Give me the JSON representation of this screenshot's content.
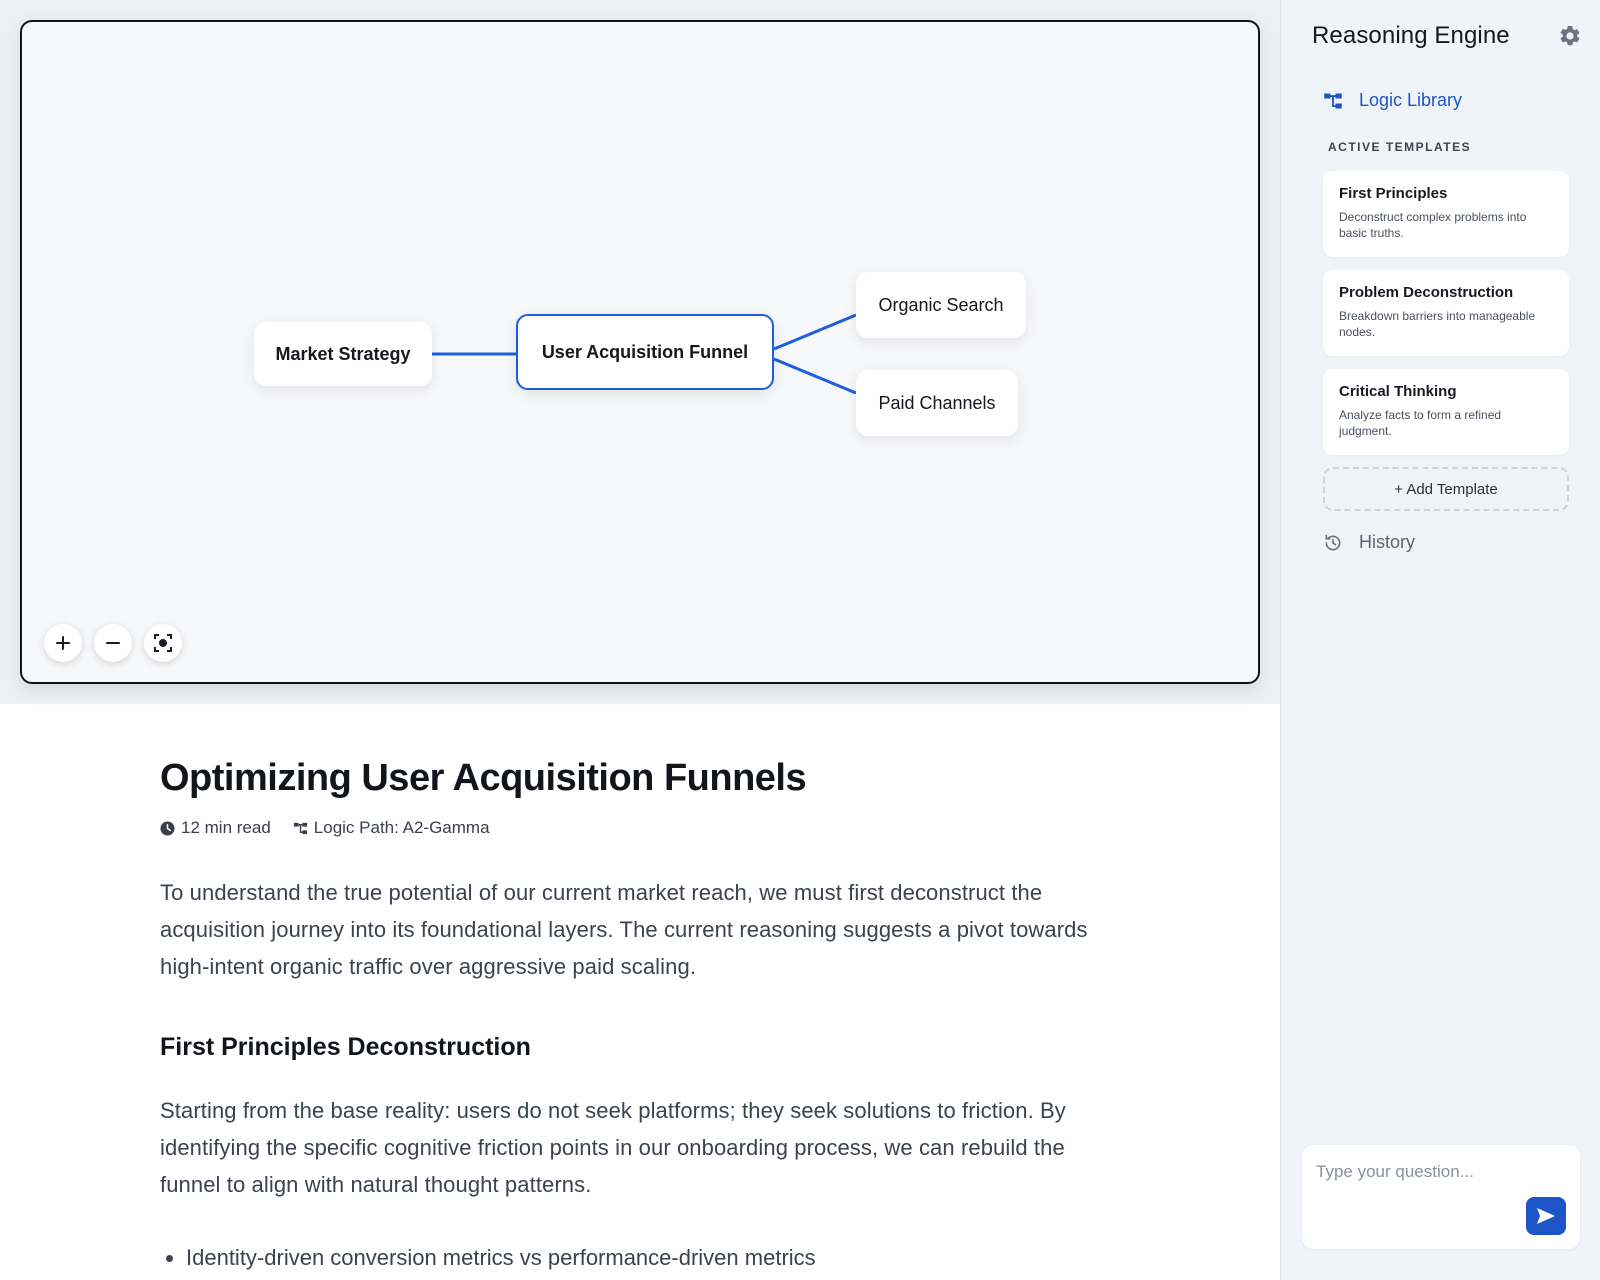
{
  "canvas": {
    "nodes": {
      "root": "Market Strategy",
      "center": "User Acquisition Funnel",
      "branch_a": "Organic Search",
      "branch_b": "Paid Channels"
    },
    "controls": {
      "zoom_in_icon": "plus-icon",
      "zoom_out_icon": "minus-icon",
      "fit_icon": "focus-icon"
    }
  },
  "article": {
    "title": "Optimizing User Acquisition Funnels",
    "read_time": "12 min read",
    "logic_path": "Logic Path: A2-Gamma",
    "intro": "To understand the true potential of our current market reach, we must first deconstruct the acquisition journey into its foundational layers. The current reasoning suggests a pivot towards high-intent organic traffic over aggressive paid scaling.",
    "section_heading": "First Principles Deconstruction",
    "section_body": "Starting from the base reality: users do not seek platforms; they seek solutions to friction. By identifying the specific cognitive friction points in our onboarding process, we can rebuild the funnel to align with natural thought patterns.",
    "bullets": [
      "Identity-driven conversion metrics vs performance-driven metrics"
    ]
  },
  "sidebar": {
    "title": "Reasoning Engine",
    "nav_library": "Logic Library",
    "section_label": "ACTIVE TEMPLATES",
    "templates": [
      {
        "title": "First Principles",
        "desc": "Deconstruct complex problems into basic truths."
      },
      {
        "title": "Problem Deconstruction",
        "desc": "Breakdown barriers into manageable nodes."
      },
      {
        "title": "Critical Thinking",
        "desc": "Analyze facts to form a refined judgment."
      }
    ],
    "add_template": "+ Add Template",
    "nav_history": "History",
    "chat_placeholder": "Type your question..."
  },
  "colors": {
    "accent": "#1d55c8",
    "edge": "#1d5fe0"
  }
}
